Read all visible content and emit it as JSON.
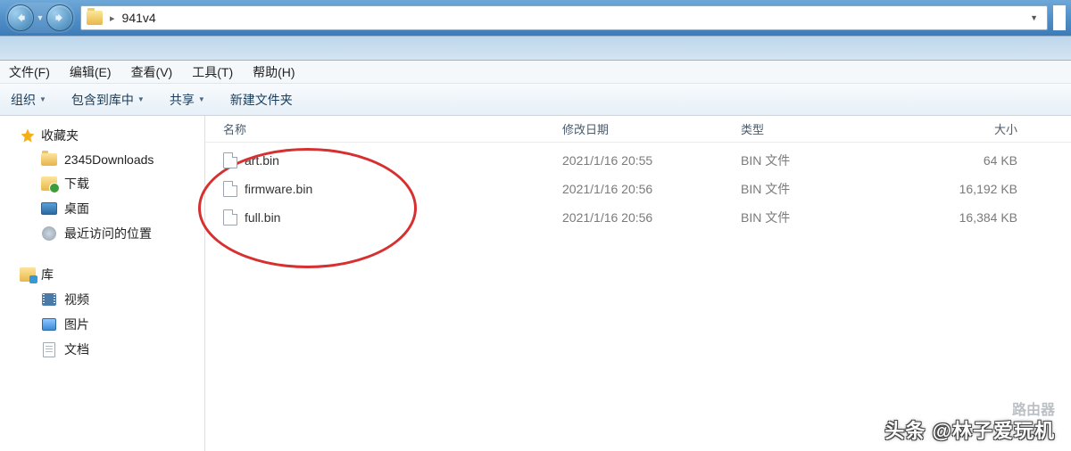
{
  "address": {
    "folder": "941v4"
  },
  "menu": {
    "file": "文件(F)",
    "edit": "编辑(E)",
    "view": "查看(V)",
    "tools": "工具(T)",
    "help": "帮助(H)"
  },
  "toolbar": {
    "organize": "组织",
    "include": "包含到库中",
    "share": "共享",
    "new_folder": "新建文件夹"
  },
  "sidebar": {
    "favorites": "收藏夹",
    "downloads": "2345Downloads",
    "download_label": "下载",
    "desktop": "桌面",
    "recent": "最近访问的位置",
    "libraries": "库",
    "videos": "视频",
    "pictures": "图片",
    "documents": "文档"
  },
  "columns": {
    "name": "名称",
    "date": "修改日期",
    "type": "类型",
    "size": "大小"
  },
  "files": [
    {
      "name": "art.bin",
      "date": "2021/1/16 20:55",
      "type": "BIN 文件",
      "size": "64 KB"
    },
    {
      "name": "firmware.bin",
      "date": "2021/1/16 20:56",
      "type": "BIN 文件",
      "size": "16,192 KB"
    },
    {
      "name": "full.bin",
      "date": "2021/1/16 20:56",
      "type": "BIN 文件",
      "size": "16,384 KB"
    }
  ],
  "watermark": {
    "line1": "头条 @林子爱玩机",
    "badge": "路由器"
  }
}
